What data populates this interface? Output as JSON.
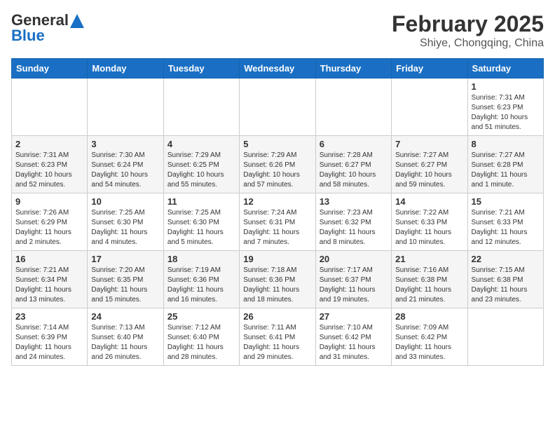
{
  "header": {
    "logo_line1": "General",
    "logo_line2": "Blue",
    "title": "February 2025",
    "subtitle": "Shiye, Chongqing, China"
  },
  "weekdays": [
    "Sunday",
    "Monday",
    "Tuesday",
    "Wednesday",
    "Thursday",
    "Friday",
    "Saturday"
  ],
  "weeks": [
    [
      {
        "day": "",
        "info": ""
      },
      {
        "day": "",
        "info": ""
      },
      {
        "day": "",
        "info": ""
      },
      {
        "day": "",
        "info": ""
      },
      {
        "day": "",
        "info": ""
      },
      {
        "day": "",
        "info": ""
      },
      {
        "day": "1",
        "info": "Sunrise: 7:31 AM\nSunset: 6:23 PM\nDaylight: 10 hours\nand 51 minutes."
      }
    ],
    [
      {
        "day": "2",
        "info": "Sunrise: 7:31 AM\nSunset: 6:23 PM\nDaylight: 10 hours\nand 52 minutes."
      },
      {
        "day": "3",
        "info": "Sunrise: 7:30 AM\nSunset: 6:24 PM\nDaylight: 10 hours\nand 54 minutes."
      },
      {
        "day": "4",
        "info": "Sunrise: 7:29 AM\nSunset: 6:25 PM\nDaylight: 10 hours\nand 55 minutes."
      },
      {
        "day": "5",
        "info": "Sunrise: 7:29 AM\nSunset: 6:26 PM\nDaylight: 10 hours\nand 57 minutes."
      },
      {
        "day": "6",
        "info": "Sunrise: 7:28 AM\nSunset: 6:27 PM\nDaylight: 10 hours\nand 58 minutes."
      },
      {
        "day": "7",
        "info": "Sunrise: 7:27 AM\nSunset: 6:27 PM\nDaylight: 10 hours\nand 59 minutes."
      },
      {
        "day": "8",
        "info": "Sunrise: 7:27 AM\nSunset: 6:28 PM\nDaylight: 11 hours\nand 1 minute."
      }
    ],
    [
      {
        "day": "9",
        "info": "Sunrise: 7:26 AM\nSunset: 6:29 PM\nDaylight: 11 hours\nand 2 minutes."
      },
      {
        "day": "10",
        "info": "Sunrise: 7:25 AM\nSunset: 6:30 PM\nDaylight: 11 hours\nand 4 minutes."
      },
      {
        "day": "11",
        "info": "Sunrise: 7:25 AM\nSunset: 6:30 PM\nDaylight: 11 hours\nand 5 minutes."
      },
      {
        "day": "12",
        "info": "Sunrise: 7:24 AM\nSunset: 6:31 PM\nDaylight: 11 hours\nand 7 minutes."
      },
      {
        "day": "13",
        "info": "Sunrise: 7:23 AM\nSunset: 6:32 PM\nDaylight: 11 hours\nand 8 minutes."
      },
      {
        "day": "14",
        "info": "Sunrise: 7:22 AM\nSunset: 6:33 PM\nDaylight: 11 hours\nand 10 minutes."
      },
      {
        "day": "15",
        "info": "Sunrise: 7:21 AM\nSunset: 6:33 PM\nDaylight: 11 hours\nand 12 minutes."
      }
    ],
    [
      {
        "day": "16",
        "info": "Sunrise: 7:21 AM\nSunset: 6:34 PM\nDaylight: 11 hours\nand 13 minutes."
      },
      {
        "day": "17",
        "info": "Sunrise: 7:20 AM\nSunset: 6:35 PM\nDaylight: 11 hours\nand 15 minutes."
      },
      {
        "day": "18",
        "info": "Sunrise: 7:19 AM\nSunset: 6:36 PM\nDaylight: 11 hours\nand 16 minutes."
      },
      {
        "day": "19",
        "info": "Sunrise: 7:18 AM\nSunset: 6:36 PM\nDaylight: 11 hours\nand 18 minutes."
      },
      {
        "day": "20",
        "info": "Sunrise: 7:17 AM\nSunset: 6:37 PM\nDaylight: 11 hours\nand 19 minutes."
      },
      {
        "day": "21",
        "info": "Sunrise: 7:16 AM\nSunset: 6:38 PM\nDaylight: 11 hours\nand 21 minutes."
      },
      {
        "day": "22",
        "info": "Sunrise: 7:15 AM\nSunset: 6:38 PM\nDaylight: 11 hours\nand 23 minutes."
      }
    ],
    [
      {
        "day": "23",
        "info": "Sunrise: 7:14 AM\nSunset: 6:39 PM\nDaylight: 11 hours\nand 24 minutes."
      },
      {
        "day": "24",
        "info": "Sunrise: 7:13 AM\nSunset: 6:40 PM\nDaylight: 11 hours\nand 26 minutes."
      },
      {
        "day": "25",
        "info": "Sunrise: 7:12 AM\nSunset: 6:40 PM\nDaylight: 11 hours\nand 28 minutes."
      },
      {
        "day": "26",
        "info": "Sunrise: 7:11 AM\nSunset: 6:41 PM\nDaylight: 11 hours\nand 29 minutes."
      },
      {
        "day": "27",
        "info": "Sunrise: 7:10 AM\nSunset: 6:42 PM\nDaylight: 11 hours\nand 31 minutes."
      },
      {
        "day": "28",
        "info": "Sunrise: 7:09 AM\nSunset: 6:42 PM\nDaylight: 11 hours\nand 33 minutes."
      },
      {
        "day": "",
        "info": ""
      }
    ]
  ]
}
